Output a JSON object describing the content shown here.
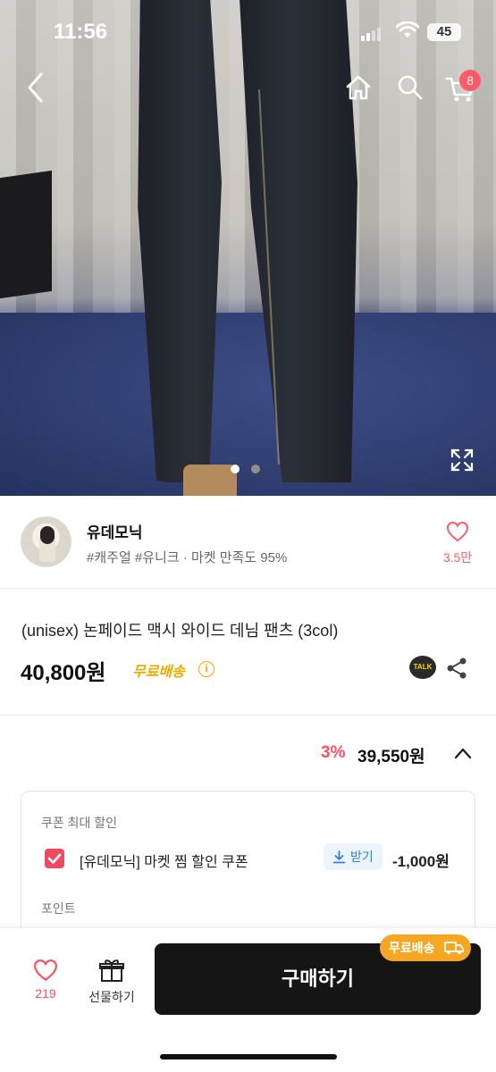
{
  "status_bar": {
    "time": "11:56",
    "battery": "45"
  },
  "header": {
    "cart_badge": "8"
  },
  "gallery": {
    "total_images": 2,
    "active_index": 0,
    "active_dot_color": "#ffffff",
    "inactive_dot_color": "#8f8f8f"
  },
  "seller": {
    "name": "유데모닉",
    "tags": "#캐주얼 #유니크 · 마켓 만족도 95%",
    "like_count": "3.5만"
  },
  "product": {
    "title": "(unisex) 논페이드 맥시 와이드 데님 팬츠 (3col)",
    "price": "40,800원",
    "free_shipping": "무료배송",
    "talk_label": "TALK"
  },
  "discount": {
    "percent": "3%",
    "price": "39,550원"
  },
  "coupon": {
    "section_label": "쿠폰 최대 할인",
    "name": "[유데모닉] 마켓 찜 할인 쿠폰",
    "receive_label": "받기",
    "amount": "-1,000원",
    "checked": true,
    "points_label": "포인트"
  },
  "bottom": {
    "like_count": "219",
    "gift_label": "선물하기",
    "buy_label": "구매하기",
    "ship_badge": "무료배송"
  },
  "colors": {
    "accent": "#ff4d5e",
    "shipping": "#f5a623",
    "buy_button": "#151515"
  }
}
